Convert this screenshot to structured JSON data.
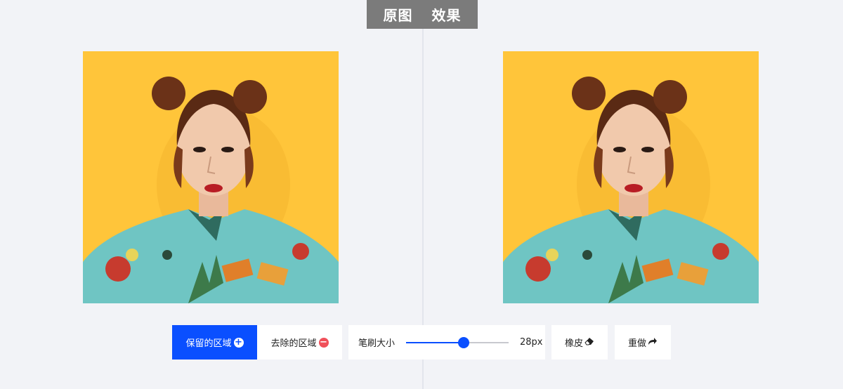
{
  "header": {
    "tabs": [
      {
        "label": "原图"
      },
      {
        "label": "效果"
      }
    ]
  },
  "images": {
    "original": {
      "icon": "portrait-photo",
      "background_color": "#ffc53a"
    },
    "result": {
      "icon": "portrait-photo",
      "background_color": "#ffc53a"
    }
  },
  "toolbar": {
    "keep_label": "保留的区域",
    "keep_icon": "plus-circle-icon",
    "remove_label": "去除的区域",
    "remove_icon": "minus-circle-icon",
    "brush_label": "笔刷大小",
    "brush_value": "28px",
    "brush_fraction": 0.56,
    "eraser_label": "橡皮",
    "eraser_icon": "eraser-icon",
    "reset_label": "重做",
    "reset_icon": "redo-icon"
  },
  "colors": {
    "accent": "#0a4fff",
    "remove": "#f0505a",
    "background": "#f2f3f7"
  }
}
